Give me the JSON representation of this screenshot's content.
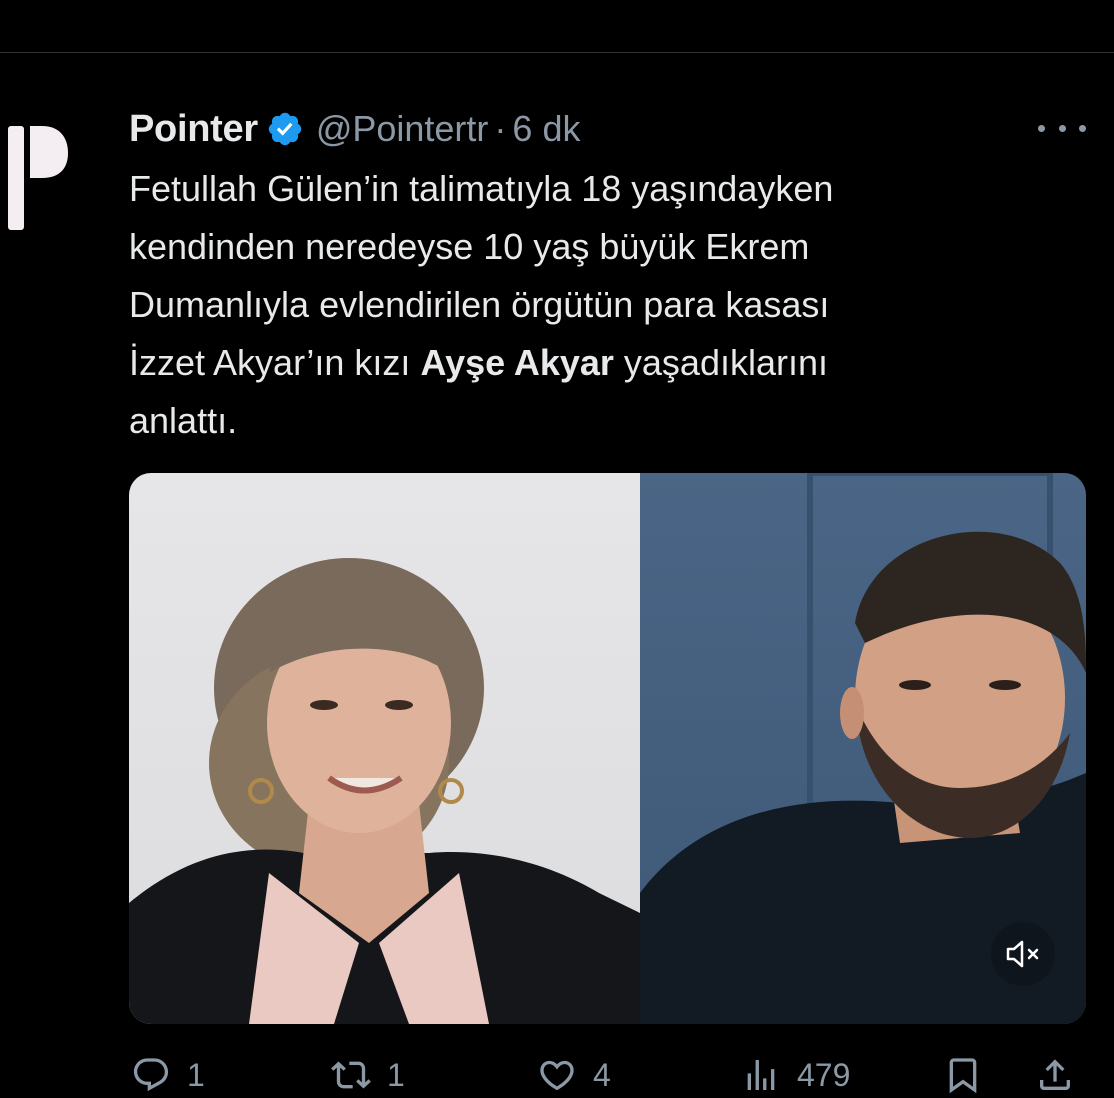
{
  "tweet": {
    "author": {
      "display_name": "Pointer",
      "handle": "@Pointertr",
      "verified": true,
      "avatar_icon": "pointer-logo-icon"
    },
    "separator": "·",
    "time": "6 dk",
    "text_lines": [
      {
        "segments": [
          {
            "text": "Fetullah Gülen’in talimatıyla 18 yaşındayken",
            "bold": false
          }
        ]
      },
      {
        "segments": [
          {
            "text": "kendinden neredeyse 10 yaş büyük Ekrem",
            "bold": false
          }
        ]
      },
      {
        "segments": [
          {
            "text": "Dumanlıyla evlendirilen örgütün para kasası",
            "bold": false
          }
        ]
      },
      {
        "segments": [
          {
            "text": "İzzet Akyar’ın kızı ",
            "bold": false
          },
          {
            "text": "Ayşe Akyar",
            "bold": true
          },
          {
            "text": " yaşadıklarını",
            "bold": false
          }
        ]
      },
      {
        "segments": [
          {
            "text": "anlattı.",
            "bold": false
          }
        ]
      }
    ],
    "media": {
      "type": "video",
      "mute_icon": "speaker-muted-icon"
    },
    "actions": {
      "reply_count": "1",
      "retweet_count": "1",
      "like_count": "4",
      "views_count": "479"
    }
  },
  "colors": {
    "background": "#000000",
    "text_primary": "#e7e9ea",
    "text_secondary": "#8b98a5",
    "verified_blue": "#1d9bf0"
  }
}
